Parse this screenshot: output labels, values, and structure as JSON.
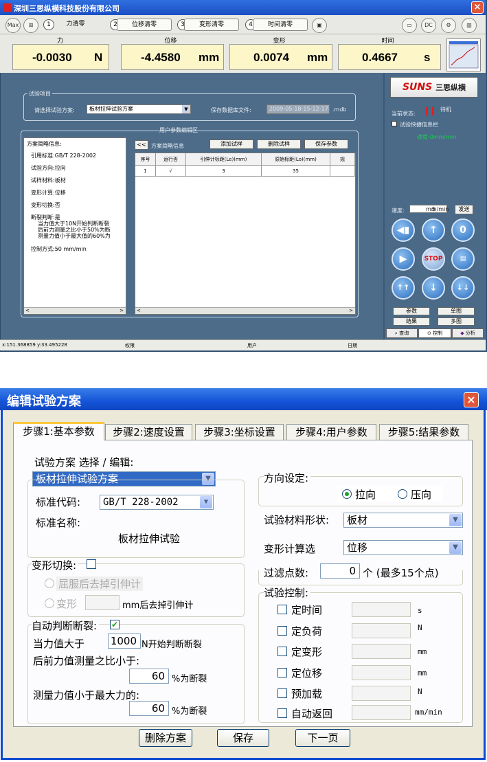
{
  "top_window": {
    "title": "深圳三思纵横科技股份有限公司",
    "toolbar": {
      "clear_buttons": [
        {
          "num": "1",
          "label": "力清零"
        },
        {
          "num": "2",
          "label": "位移清零"
        },
        {
          "num": "3",
          "label": "变形清零"
        },
        {
          "num": "4",
          "label": "时间清零"
        }
      ]
    },
    "readouts": [
      {
        "label": "力",
        "value": "-0.0030",
        "unit": "N"
      },
      {
        "label": "位移",
        "value": "-4.4580",
        "unit": "mm"
      },
      {
        "label": "变形",
        "value": "0.0074",
        "unit": "mm"
      },
      {
        "label": "时间",
        "value": "0.4667",
        "unit": "s"
      }
    ],
    "test_project": {
      "group_label": "试验项目",
      "select_label": "请选择试验方案:",
      "selected_plan": "板材拉伸试验方案",
      "save_label": "保存数据库文件:",
      "save_file": "2009-05-18-15-12-17",
      "save_ext": ".mdb"
    },
    "param_area_title": "用户参数编辑区",
    "summary_title": "方案简略信息:",
    "summary_lines": [
      "引用标准:GB/T 228-2002",
      "试验方向:拉向",
      "试样材料:板材",
      "变形计算:位移",
      "变形切换:否",
      "断裂判断:是",
      "当力值大于10N开始判断断裂",
      "后前力测量之比小于50%为断",
      "测量力值小于最大值的60%为",
      "控制方式:50 mm/min"
    ],
    "grid_toolbar": {
      "collapse": "<<",
      "summary_btn": "方案简略信息",
      "add": "添加试样",
      "delete": "删除试样",
      "save": "保存参数"
    },
    "grid": {
      "headers": [
        "序号",
        "运行否",
        "引伸计标距(Le)(mm)",
        "原始标距(Lo)(mm)",
        "规"
      ],
      "rows": [
        [
          "1",
          "√",
          "3",
          "35",
          ""
        ]
      ]
    },
    "side": {
      "brand": "三思纵横",
      "status_label": "当前状态:",
      "status_value": "待机",
      "quick_info": "试验快捷信息栏",
      "speed_text": "速度:0mm/min",
      "speed_label": "速度:",
      "speed_value": "5",
      "speed_unit": "mm/min",
      "send": "发送",
      "stop": "STOP",
      "btn_params": "参数",
      "btn_single": "单图",
      "btn_result": "结果",
      "btn_multi": "多图",
      "tabs": [
        "查询",
        "控制",
        "分析"
      ]
    },
    "status_bar": {
      "coords": "x:151.368859 y:33.495228",
      "perm": "权限",
      "user": "用户",
      "date": "日期"
    }
  },
  "dialog": {
    "title": "编辑试验方案",
    "tabs": [
      "步骤1:基本参数",
      "步骤2:速度设置",
      "步骤3:坐标设置",
      "步骤4:用户参数",
      "步骤5:结果参数"
    ],
    "plan_label": "试验方案  选择 / 编辑:",
    "plan_value": "板材拉伸试验方案",
    "std_code_label": "标准代码:",
    "std_code_value": "GB/T 228-2002",
    "std_name_label": "标准名称:",
    "std_name_value": "板材拉伸试验",
    "deform_switch_label": "变形切换:",
    "opt_yield": "屈服后去掉引伸计",
    "opt_deform": "变形",
    "opt_deform_suffix": "mm后去掉引伸计",
    "auto_break_label": "自动判断断裂:",
    "force_gt_label": "当力值大于",
    "force_gt_value": "1000",
    "force_gt_suffix": "N开始判断断裂",
    "ratio_label": "后前力值测量之比小于:",
    "ratio_value": "60",
    "ratio_suffix": "%为断裂",
    "max_label": "测量力值小于最大力的:",
    "max_value": "60",
    "max_suffix": "%为断裂",
    "direction_label": "方向设定:",
    "dir_pull": "拉向",
    "dir_push": "压向",
    "shape_label": "试验材料形状:",
    "shape_value": "板材",
    "deform_calc_label": "变形计算选",
    "deform_calc_value": "位移",
    "filter_label": "过滤点数:",
    "filter_value": "0",
    "filter_suffix": "个 (最多15个点)",
    "control_label": "试验控制:",
    "controls": [
      {
        "label": "定时间",
        "unit": "s"
      },
      {
        "label": "定负荷",
        "unit": "N"
      },
      {
        "label": "定变形",
        "unit": "mm"
      },
      {
        "label": "定位移",
        "unit": "mm"
      },
      {
        "label": "预加载",
        "unit": "N"
      },
      {
        "label": "自动返回",
        "unit": "mm/min"
      }
    ],
    "buttons": {
      "delete": "删除方案",
      "save": "保存",
      "next": "下一页"
    }
  }
}
